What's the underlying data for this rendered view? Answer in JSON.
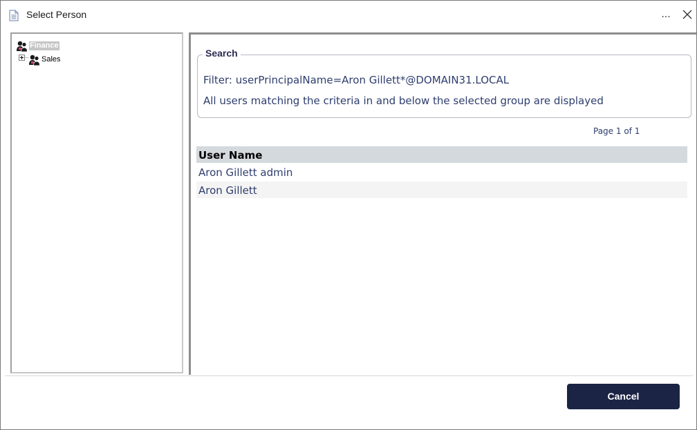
{
  "window": {
    "title": "Select Person",
    "more_label": "...",
    "close_icon": "close-icon"
  },
  "tree": {
    "items": [
      {
        "label": "Finance",
        "selected": true,
        "icon": "people-icon"
      },
      {
        "label": "Sales",
        "selected": false,
        "icon": "people-icon",
        "expander": "plus"
      }
    ]
  },
  "search": {
    "legend": "Search",
    "filter_text": "Filter: userPrincipalName=Aron Gillett*@DOMAIN31.LOCAL",
    "info_text": "All users matching the criteria in and below the selected group are displayed"
  },
  "pagination": {
    "text": "Page 1 of 1"
  },
  "grid": {
    "columns": [
      "User Name"
    ],
    "rows": [
      {
        "user_name": "Aron Gillett admin"
      },
      {
        "user_name": "Aron Gillett"
      }
    ]
  },
  "footer": {
    "cancel_label": "Cancel"
  },
  "colors": {
    "button_bg": "#1b2445",
    "text_blue": "#2e3d6e",
    "header_bg": "#d4d9dd"
  }
}
